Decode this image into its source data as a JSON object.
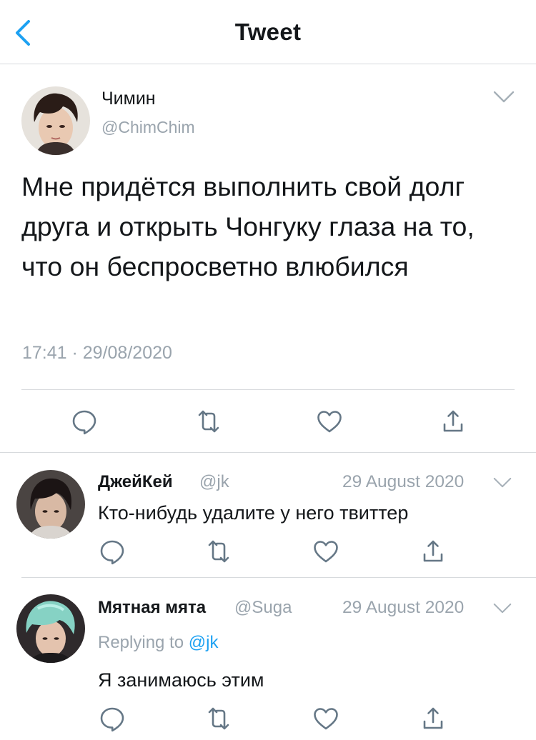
{
  "header": {
    "title": "Tweet"
  },
  "main_tweet": {
    "name": "Чимин",
    "handle": "@ChimChim",
    "text": "Мне придётся выполнить свой долг друга и открыть Чонгуку глаза на то, что он беспросветно влюбился",
    "timestamp": "17:41 · 29/08/2020"
  },
  "replies": [
    {
      "name": "ДжейКей",
      "handle": "@jk",
      "date": "29 August 2020",
      "text": "Кто-нибудь удалите у него твиттер"
    },
    {
      "name": "Мятная мята",
      "handle": "@Suga",
      "date": "29 August 2020",
      "replying_prefix": "Replying to",
      "replying_to": "@jk",
      "text": "Я занимаюсь этим"
    }
  ],
  "icons": {
    "back": "chevron-left-icon",
    "more": "chevron-down-icon",
    "reply": "reply-icon",
    "retweet": "retweet-icon",
    "like": "heart-icon",
    "share": "share-icon"
  },
  "colors": {
    "accent": "#1da1f2",
    "text": "#14171a",
    "secondary": "#9aa4ad",
    "icon": "#657786",
    "divider": "#d7dadd"
  }
}
